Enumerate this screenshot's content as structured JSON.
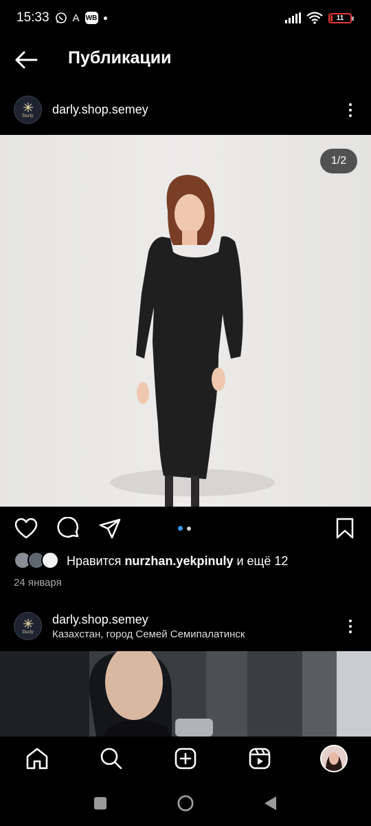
{
  "status_bar": {
    "time": "15:33",
    "badge": "WB",
    "carrier_letter": "A",
    "battery_level": "11",
    "battery_color": "#e53935"
  },
  "header": {
    "title": "Публикации",
    "back_icon": "arrow-left-icon"
  },
  "post1": {
    "username": "darly.shop.semey",
    "avatar_text": "Darly",
    "image_counter": "1/2",
    "likes_prefix": "Нравится ",
    "likes_user": "nurzhan.yekpinuly",
    "likes_suffix": " и ещё 12",
    "date": "24 января",
    "carousel_active_color": "#3897f0"
  },
  "post2": {
    "username": "darly.shop.semey",
    "avatar_text": "Darly",
    "location": "Казахстан, город Семей Семипалатинск"
  },
  "actions": {
    "icons": [
      "heart-icon",
      "comment-icon",
      "share-icon",
      "bookmark-icon"
    ]
  },
  "bottom_nav": {
    "icons": [
      "home-icon",
      "search-icon",
      "create-icon",
      "reels-icon",
      "profile-avatar"
    ]
  },
  "system_nav": {
    "icons": [
      "recents-icon",
      "home-circle-icon",
      "back-triangle-icon"
    ]
  }
}
